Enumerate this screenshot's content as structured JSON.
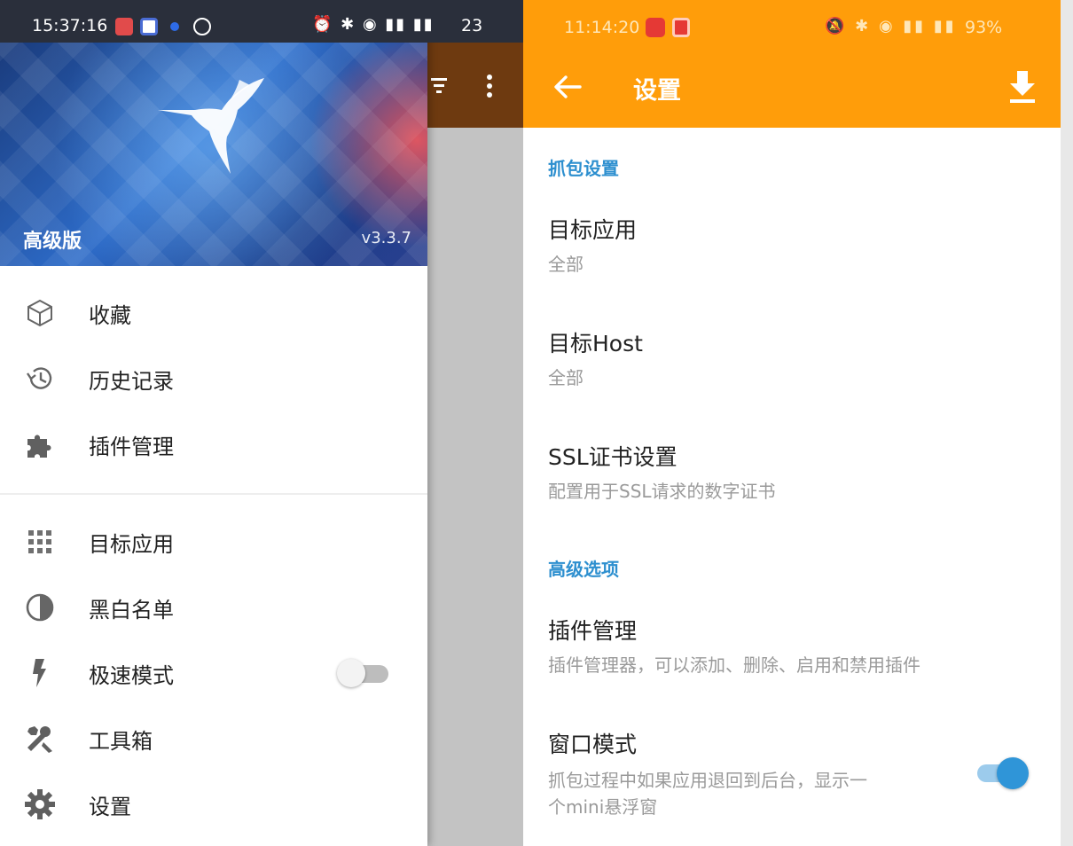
{
  "left_phone": {
    "status_bar": {
      "time": "15:37:16",
      "battery": "23"
    },
    "header": {
      "edition": "高级版",
      "version": "v3.3.7"
    },
    "menu_group_1": [
      {
        "label": "收藏",
        "icon": "cube-icon"
      },
      {
        "label": "历史记录",
        "icon": "history-icon"
      },
      {
        "label": "插件管理",
        "icon": "puzzle-icon"
      }
    ],
    "menu_group_2": [
      {
        "label": "目标应用",
        "icon": "apps-grid-icon"
      },
      {
        "label": "黑白名单",
        "icon": "contrast-icon"
      },
      {
        "label": "极速模式",
        "icon": "flash-icon",
        "toggle": false
      },
      {
        "label": "工具箱",
        "icon": "tools-icon"
      },
      {
        "label": "设置",
        "icon": "gear-icon"
      }
    ]
  },
  "right_phone": {
    "status_bar": {
      "time": "11:14:20",
      "battery": "93%"
    },
    "app_bar": {
      "title": "设置"
    },
    "sections": [
      {
        "header": "抓包设置",
        "prefs": [
          {
            "title": "目标应用",
            "summary": "全部"
          },
          {
            "title": "目标Host",
            "summary": "全部"
          },
          {
            "title": "SSL证书设置",
            "summary": "配置用于SSL请求的数字证书"
          }
        ]
      },
      {
        "header": "高级选项",
        "prefs": [
          {
            "title": "插件管理",
            "summary": "插件管理器，可以添加、删除、启用和禁用插件"
          },
          {
            "title": "窗口模式",
            "summary_line1": "抓包过程中如果应用退回到后台，显示一",
            "summary_line2": "个mini悬浮窗",
            "toggle": true
          }
        ]
      }
    ]
  },
  "colors": {
    "accent_orange": "#ff9d0a",
    "section_blue": "#2d8fcf",
    "switch_blue": "#2f95d8"
  }
}
